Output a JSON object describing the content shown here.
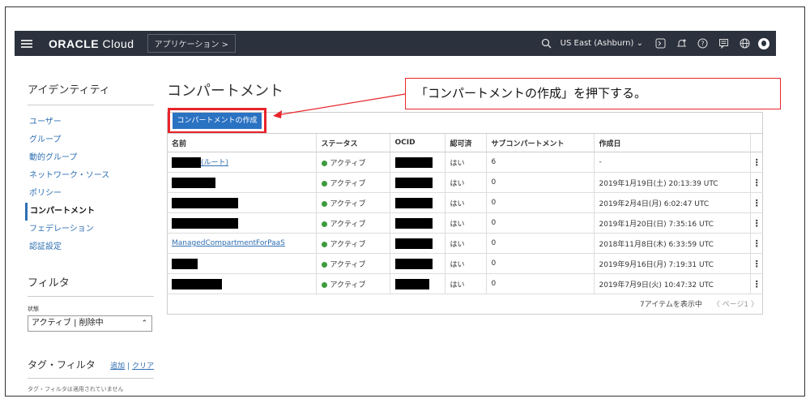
{
  "topbar": {
    "logo_bold": "ORACLE",
    "logo_rest": "Cloud",
    "app_button": "アプリケーション >",
    "region": "US East (Ashburn)",
    "icons": [
      "search-icon",
      "chevron-down-icon",
      "cloud-shell-icon",
      "bell-icon",
      "help-icon",
      "chat-icon",
      "globe-icon",
      "user-icon"
    ]
  },
  "sidebar": {
    "title": "アイデンティティ",
    "items": [
      {
        "label": "ユーザー"
      },
      {
        "label": "グループ"
      },
      {
        "label": "動的グループ"
      },
      {
        "label": "ネットワーク・ソース"
      },
      {
        "label": "ポリシー"
      },
      {
        "label": "コンパートメント"
      },
      {
        "label": "フェデレーション"
      },
      {
        "label": "認証設定"
      }
    ],
    "active_item": "コンパートメント",
    "filter_title": "フィルタ",
    "state_label": "状態",
    "state_value": "アクティブ | 削除中",
    "tag_filter_title": "タグ・フィルタ",
    "tag_add": "追加",
    "tag_sep": "|",
    "tag_clear": "クリア",
    "tag_note": "タグ・フィルタは適用されていません"
  },
  "main": {
    "title": "コンパートメント",
    "create_button": "コンパートメントの作成",
    "columns": [
      "名前",
      "ステータス",
      "OCID",
      "認可済",
      "サブコンパートメント",
      "作成日"
    ],
    "rows": [
      {
        "name": "(ルート)",
        "status": "アクティブ",
        "authorized": "はい",
        "sub": "6",
        "created": "-"
      },
      {
        "name": "",
        "status": "アクティブ",
        "authorized": "はい",
        "sub": "0",
        "created": "2019年1月19日(土) 20:13:39 UTC"
      },
      {
        "name": "",
        "status": "アクティブ",
        "authorized": "はい",
        "sub": "0",
        "created": "2019年2月4日(月) 6:02:47 UTC"
      },
      {
        "name": "",
        "status": "アクティブ",
        "authorized": "はい",
        "sub": "0",
        "created": "2019年1月20日(日) 7:35:16 UTC"
      },
      {
        "name": "ManagedCompartmentForPaaS",
        "status": "アクティブ",
        "authorized": "はい",
        "sub": "0",
        "created": "2018年11月8日(木) 6:33:59 UTC"
      },
      {
        "name": "",
        "status": "アクティブ",
        "authorized": "はい",
        "sub": "0",
        "created": "2019年9月16日(月) 7:19:31 UTC"
      },
      {
        "name": "",
        "status": "アクティブ",
        "authorized": "はい",
        "sub": "0",
        "created": "2019年7月9日(火) 10:47:32 UTC"
      }
    ],
    "footer_count": "7アイテムを表示中",
    "footer_page": "〈 ページ1 〉"
  },
  "callout": {
    "text": "「コンパートメントの作成」を押下する。"
  },
  "colors": {
    "topbar": "#2b313d",
    "link": "#2f6fb3",
    "button": "#2a72c2",
    "highlight": "#e8242a",
    "active_status": "#3d9b3d"
  }
}
